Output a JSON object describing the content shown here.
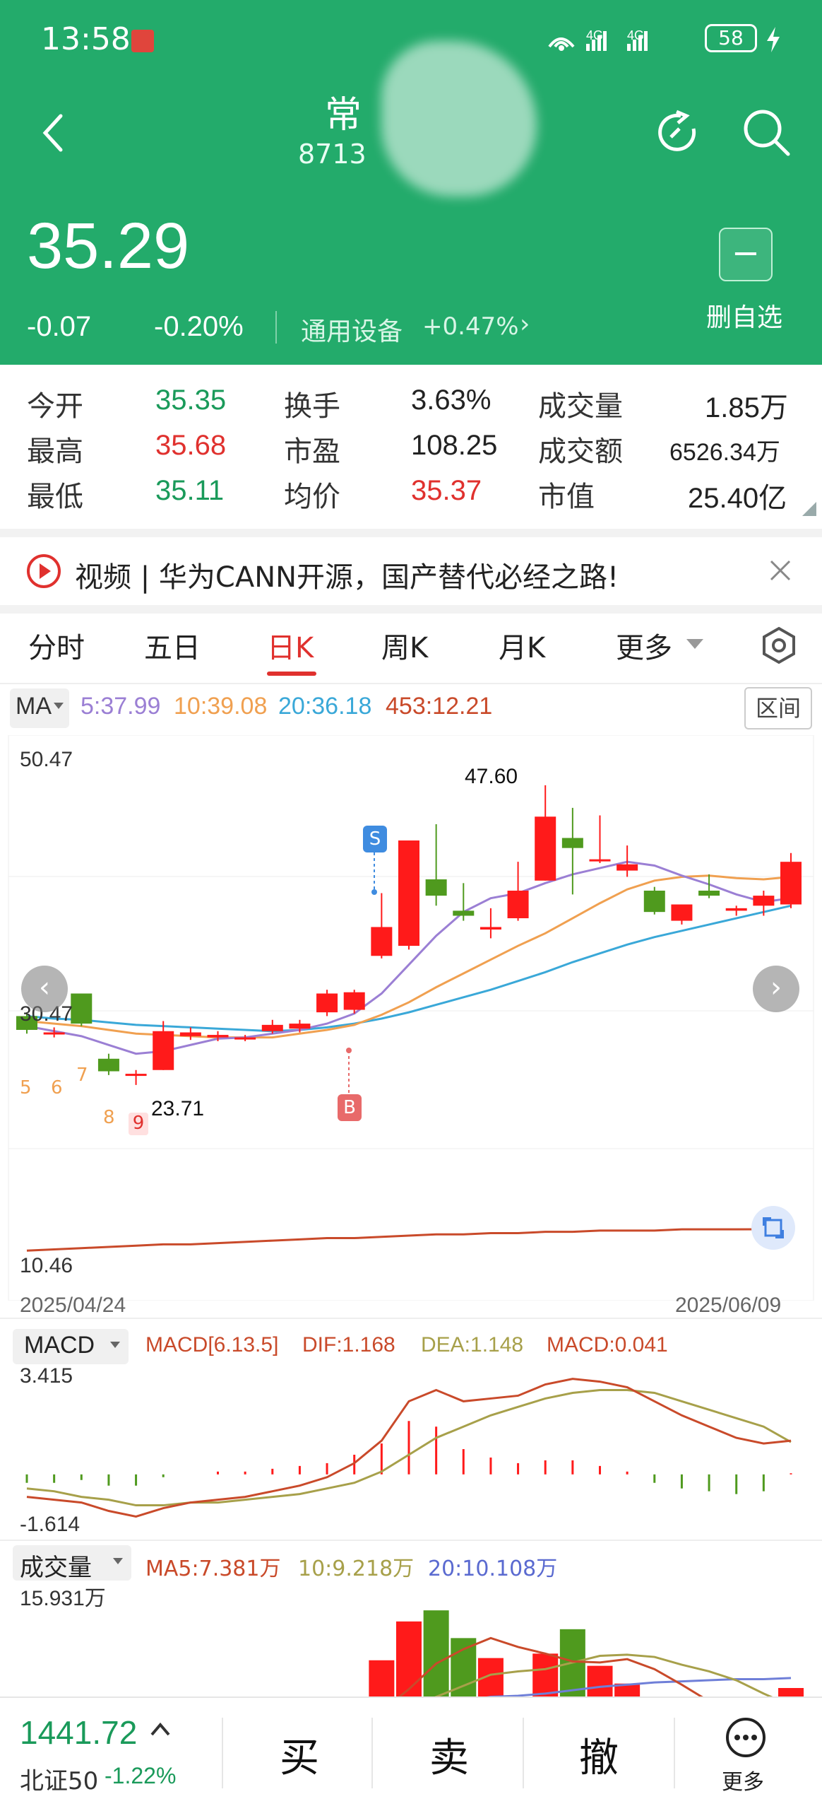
{
  "status_bar": {
    "time": "13:58",
    "network": "4G 4G",
    "battery": "58"
  },
  "header": {
    "stock_name": "常",
    "stock_code": "8713",
    "price": "35.29",
    "change": "-0.07",
    "change_pct": "-0.20%",
    "industry": "通用设备",
    "industry_pct": "+0.47%",
    "remove_watchlist_label": "删自选"
  },
  "stats": [
    {
      "label": "今开",
      "value": "35.35",
      "color": "#1a9a5a"
    },
    {
      "label": "换手",
      "value": "3.63%",
      "color": "#222222"
    },
    {
      "label": "成交量",
      "value": "1.85万",
      "color": "#222222"
    },
    {
      "label": "最高",
      "value": "35.68",
      "color": "#e0312e"
    },
    {
      "label": "市盈",
      "value": "108.25",
      "color": "#222222"
    },
    {
      "label": "成交额",
      "value": "6526.34万",
      "color": "#222222"
    },
    {
      "label": "最低",
      "value": "35.11",
      "color": "#1a9a5a"
    },
    {
      "label": "均价",
      "value": "35.37",
      "color": "#e0312e"
    },
    {
      "label": "市值",
      "value": "25.40亿",
      "color": "#222222"
    }
  ],
  "banner": {
    "text": "视频 | 华为CANN开源，国产替代必经之路!"
  },
  "tabs": [
    "分时",
    "五日",
    "日K",
    "周K",
    "月K",
    "更多"
  ],
  "active_tab": "日K",
  "ma": {
    "selector": "MA",
    "ma5": "5:37.99",
    "ma10": "10:39.08",
    "ma20": "20:36.18",
    "ma453": "453:12.21",
    "range_button": "区间"
  },
  "kline": {
    "ytop": "50.47",
    "ymid": "30.47",
    "ybottom": "10.46",
    "high_label": "47.60",
    "low_label": "23.71",
    "date_start": "2025/04/24",
    "date_end": "2025/06/09",
    "markers": [
      "5",
      "6",
      "7",
      "8",
      "9"
    ],
    "signal_sell": "S",
    "signal_buy": "B"
  },
  "macd": {
    "selector": "MACD",
    "params": "MACD[6.13.5]",
    "dif": "DIF:1.168",
    "dea": "DEA:1.148",
    "macd": "MACD:0.041",
    "ymax": "3.415",
    "ymin": "-1.614"
  },
  "volume": {
    "selector": "成交量",
    "ma5": "MA5:7.381万",
    "ma10": "10:9.218万",
    "ma20": "20:10.108万",
    "ymax": "15.931万"
  },
  "colors": {
    "up": "#ff1a1a",
    "down": "#4f9a1e",
    "ma5": "#9b7fd4",
    "ma10": "#f0a050",
    "ma20": "#3aa8d8",
    "ma453": "#c94a2a"
  },
  "chart_data": {
    "type": "candlestick",
    "x": [
      "2025/04/24",
      "2025/06/09"
    ],
    "candles": [
      {
        "o": 29.2,
        "c": 28.1,
        "h": 29.5,
        "l": 27.8
      },
      {
        "o": 27.8,
        "c": 27.9,
        "h": 28.3,
        "l": 27.5
      },
      {
        "o": 31.0,
        "c": 28.6,
        "h": 31.0,
        "l": 28.4
      },
      {
        "o": 25.8,
        "c": 24.8,
        "h": 26.2,
        "l": 24.5
      },
      {
        "o": 24.5,
        "c": 24.6,
        "h": 24.9,
        "l": 23.71
      },
      {
        "o": 24.9,
        "c": 28.0,
        "h": 28.8,
        "l": 24.9
      },
      {
        "o": 27.6,
        "c": 27.9,
        "h": 28.3,
        "l": 27.3
      },
      {
        "o": 27.5,
        "c": 27.7,
        "h": 28.0,
        "l": 27.2
      },
      {
        "o": 27.4,
        "c": 27.5,
        "h": 27.7,
        "l": 27.2
      },
      {
        "o": 28.0,
        "c": 28.5,
        "h": 28.9,
        "l": 27.8
      },
      {
        "o": 28.2,
        "c": 28.6,
        "h": 28.9,
        "l": 27.9
      },
      {
        "o": 29.5,
        "c": 31.0,
        "h": 31.3,
        "l": 29.2
      },
      {
        "o": 29.7,
        "c": 31.1,
        "h": 31.3,
        "l": 29.4
      },
      {
        "o": 34.0,
        "c": 36.3,
        "h": 39.0,
        "l": 33.8
      },
      {
        "o": 34.8,
        "c": 43.2,
        "h": 43.2,
        "l": 34.5
      },
      {
        "o": 40.1,
        "c": 38.8,
        "h": 44.5,
        "l": 38.0
      },
      {
        "o": 37.6,
        "c": 37.2,
        "h": 39.8,
        "l": 36.8
      },
      {
        "o": 36.1,
        "c": 36.3,
        "h": 37.8,
        "l": 35.4
      },
      {
        "o": 37.0,
        "c": 39.2,
        "h": 41.5,
        "l": 36.8
      },
      {
        "o": 40.0,
        "c": 45.1,
        "h": 47.6,
        "l": 40.0
      },
      {
        "o": 43.4,
        "c": 42.6,
        "h": 45.8,
        "l": 38.9
      },
      {
        "o": 41.6,
        "c": 41.7,
        "h": 45.2,
        "l": 41.4
      },
      {
        "o": 40.8,
        "c": 41.3,
        "h": 42.8,
        "l": 40.3
      },
      {
        "o": 39.2,
        "c": 37.5,
        "h": 39.5,
        "l": 37.3
      },
      {
        "o": 36.8,
        "c": 38.1,
        "h": 38.1,
        "l": 36.5
      },
      {
        "o": 39.2,
        "c": 38.8,
        "h": 40.5,
        "l": 38.6
      },
      {
        "o": 37.6,
        "c": 37.8,
        "h": 38.0,
        "l": 37.2
      },
      {
        "o": 38.0,
        "c": 38.8,
        "h": 39.2,
        "l": 37.2
      },
      {
        "o": 38.1,
        "c": 41.5,
        "h": 42.2,
        "l": 37.8
      }
    ],
    "ma5": [
      28.4,
      28.0,
      27.6,
      26.9,
      26.2,
      26.4,
      26.9,
      27.4,
      27.5,
      27.8,
      28.1,
      28.6,
      29.4,
      31.0,
      33.3,
      35.6,
      37.5,
      38.6,
      39.0,
      39.8,
      40.5,
      41.0,
      41.5,
      41.2,
      40.4,
      39.7,
      38.9,
      38.3,
      38.6
    ],
    "ma10": [
      28.8,
      28.6,
      28.4,
      28.1,
      27.8,
      27.7,
      27.6,
      27.5,
      27.5,
      27.5,
      27.8,
      28.1,
      28.5,
      29.3,
      30.3,
      31.5,
      32.6,
      33.7,
      34.8,
      35.8,
      37.0,
      38.2,
      39.3,
      40.0,
      40.3,
      40.4,
      40.2,
      40.1,
      40.3
    ],
    "ma20": [
      29.2,
      29.0,
      28.9,
      28.7,
      28.5,
      28.4,
      28.3,
      28.2,
      28.1,
      28.0,
      28.1,
      28.3,
      28.6,
      29.0,
      29.5,
      30.1,
      30.7,
      31.3,
      32.0,
      32.7,
      33.5,
      34.2,
      34.9,
      35.5,
      36.0,
      36.5,
      37.0,
      37.5,
      38.0
    ],
    "macd_dif": [
      -0.8,
      -0.9,
      -1.0,
      -1.3,
      -1.5,
      -1.2,
      -1.0,
      -0.9,
      -0.8,
      -0.6,
      -0.4,
      -0.1,
      0.4,
      1.2,
      2.6,
      3.0,
      2.6,
      2.7,
      2.8,
      3.2,
      3.4,
      3.3,
      3.1,
      2.6,
      2.1,
      1.7,
      1.3,
      1.1,
      1.2
    ],
    "macd_dea": [
      -0.5,
      -0.6,
      -0.8,
      -0.9,
      -1.1,
      -1.1,
      -1.0,
      -1.0,
      -0.9,
      -0.8,
      -0.7,
      -0.5,
      -0.3,
      0.1,
      0.7,
      1.3,
      1.7,
      2.1,
      2.4,
      2.7,
      2.9,
      3.0,
      3.0,
      2.9,
      2.6,
      2.3,
      2.0,
      1.7,
      1.15
    ],
    "macd_hist": [
      -0.3,
      -0.3,
      -0.2,
      -0.4,
      -0.4,
      -0.1,
      0.0,
      0.1,
      0.1,
      0.2,
      0.3,
      0.4,
      0.7,
      1.1,
      1.9,
      1.7,
      0.9,
      0.6,
      0.4,
      0.5,
      0.5,
      0.3,
      0.1,
      -0.3,
      -0.5,
      -0.6,
      -0.7,
      -0.6,
      0.04
    ],
    "volume": [
      5.2,
      4.1,
      4.6,
      2.3,
      1.8,
      4.8,
      2.6,
      2.2,
      2.0,
      2.4,
      2.1,
      4.6,
      3.8,
      9.0,
      12.5,
      13.5,
      11.0,
      9.2,
      4.8,
      9.6,
      11.8,
      8.5,
      6.9,
      4.3,
      2.4,
      3.5,
      1.6,
      1.3,
      6.5
    ],
    "vol_ma5": [
      5.6,
      5.2,
      4.9,
      4.4,
      3.6,
      3.5,
      3.2,
      2.7,
      2.7,
      2.8,
      2.7,
      2.8,
      3.0,
      4.4,
      6.4,
      8.7,
      10.0,
      11.0,
      10.2,
      9.6,
      8.9,
      8.8,
      9.1,
      8.2,
      6.8,
      5.3,
      3.7,
      2.6,
      3.1
    ],
    "vol_ma10": [
      5.0,
      4.9,
      4.8,
      4.6,
      4.3,
      4.2,
      4.0,
      3.8,
      3.6,
      3.4,
      3.2,
      3.1,
      3.0,
      3.5,
      4.5,
      5.7,
      6.7,
      7.7,
      8.0,
      8.2,
      8.8,
      9.4,
      9.5,
      9.3,
      8.6,
      8.0,
      7.2,
      6.0,
      4.9
    ],
    "vol_ma20": [
      4.5,
      4.5,
      4.5,
      4.4,
      4.3,
      4.3,
      4.2,
      4.1,
      4.0,
      3.9,
      3.8,
      3.8,
      3.8,
      4.0,
      4.4,
      4.9,
      5.3,
      5.7,
      5.8,
      6.0,
      6.3,
      6.6,
      6.8,
      7.0,
      7.1,
      7.2,
      7.3,
      7.3,
      7.4
    ],
    "ma453": [
      10.5,
      10.6,
      10.7,
      10.8,
      10.9,
      11.0,
      11.0,
      11.1,
      11.2,
      11.3,
      11.4,
      11.5,
      11.5,
      11.6,
      11.7,
      11.8,
      11.8,
      11.9,
      11.9,
      12.0,
      12.0,
      12.1,
      12.1,
      12.1,
      12.2,
      12.2,
      12.2,
      12.21,
      12.21
    ],
    "ylim": [
      10.46,
      50.47
    ]
  },
  "bottom": {
    "index_value": "1441.72",
    "index_name": "北证50",
    "index_pct": "-1.22%",
    "buy": "买",
    "sell": "卖",
    "cancel": "撤",
    "more": "更多"
  }
}
